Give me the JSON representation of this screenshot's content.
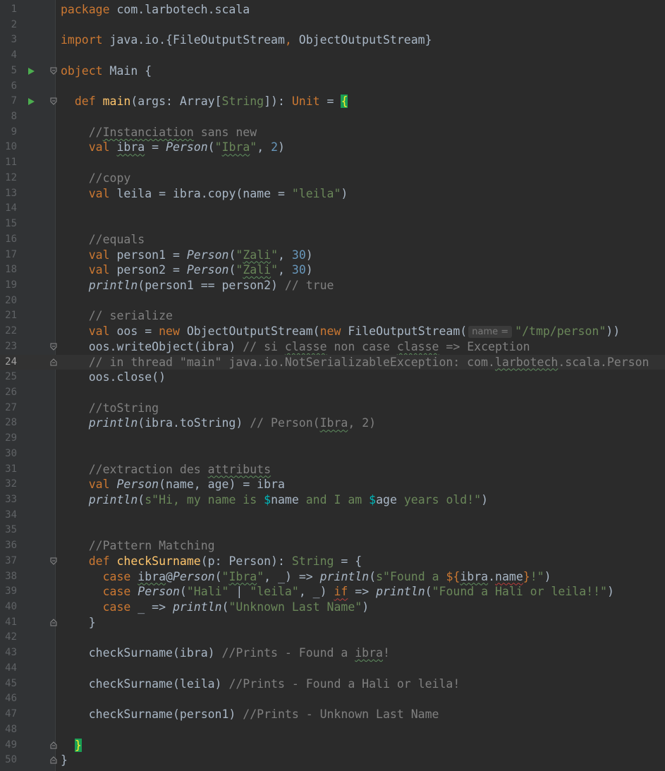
{
  "editor": {
    "language": "scala",
    "current_line": "24",
    "colors": {
      "background": "#2b2b2b",
      "gutter": "#313335",
      "keyword": "#cc7832",
      "string": "#6a8759",
      "number": "#6897bb",
      "comment": "#808080",
      "function": "#ffc66d",
      "run_marker": "#4cae4f",
      "brace_highlight": "#1b9e55"
    },
    "lines": [
      {
        "n": "1"
      },
      {
        "n": "2"
      },
      {
        "n": "3"
      },
      {
        "n": "4"
      },
      {
        "n": "5"
      },
      {
        "n": "6"
      },
      {
        "n": "7"
      },
      {
        "n": "8"
      },
      {
        "n": "9"
      },
      {
        "n": "10"
      },
      {
        "n": "11"
      },
      {
        "n": "12"
      },
      {
        "n": "13"
      },
      {
        "n": "14"
      },
      {
        "n": "15"
      },
      {
        "n": "16"
      },
      {
        "n": "17"
      },
      {
        "n": "18"
      },
      {
        "n": "19"
      },
      {
        "n": "20"
      },
      {
        "n": "21"
      },
      {
        "n": "22"
      },
      {
        "n": "23"
      },
      {
        "n": "24"
      },
      {
        "n": "25"
      },
      {
        "n": "26"
      },
      {
        "n": "27"
      },
      {
        "n": "28"
      },
      {
        "n": "29"
      },
      {
        "n": "30"
      },
      {
        "n": "31"
      },
      {
        "n": "32"
      },
      {
        "n": "33"
      },
      {
        "n": "34"
      },
      {
        "n": "35"
      },
      {
        "n": "36"
      },
      {
        "n": "37"
      },
      {
        "n": "38"
      },
      {
        "n": "39"
      },
      {
        "n": "40"
      },
      {
        "n": "41"
      },
      {
        "n": "42"
      },
      {
        "n": "43"
      },
      {
        "n": "44"
      },
      {
        "n": "45"
      },
      {
        "n": "46"
      },
      {
        "n": "47"
      },
      {
        "n": "48"
      },
      {
        "n": "49"
      },
      {
        "n": "50"
      }
    ],
    "run_markers": [
      "5",
      "7"
    ],
    "fold_markers": [
      "5",
      "7",
      "23",
      "24",
      "37",
      "41",
      "49",
      "50"
    ],
    "code": {
      "l1_kw": "package",
      "l1_rest": " com.larbotech.scala",
      "l3_kw": "import",
      "l3_a": " java.io.{FileOutputStream",
      "l3_comma": ",",
      "l3_b": " ObjectOutputStream}",
      "l5_kw": "object",
      "l5_rest": " Main {",
      "l7_kw": "def",
      "l7_fn": "main",
      "l7_a": "(args: Array[",
      "l7_type": "String",
      "l7_b": "]): ",
      "l7_unit": "Unit",
      "l7_c": " = ",
      "l7_brace": "{",
      "l9_a": "//",
      "l9_b": "Instanciation",
      "l9_c": " sans new",
      "l10_kw": "val",
      "l10_sp": " ",
      "l10_var": "ibra",
      "l10_eq": " = ",
      "l10_cls": "Person",
      "l10_p": "(",
      "l10_q1": "\"",
      "l10_s": "Ibra",
      "l10_q2": "\"",
      "l10_c": ", ",
      "l10_n": "2",
      "l10_e": ")",
      "l12": "//copy",
      "l13_kw": "val",
      "l13_rest": " leila = ibra.copy(name = ",
      "l13_s": "\"leila\"",
      "l13_e": ")",
      "l16": "//equals",
      "l17_kw": "val",
      "l17_a": " person1 = ",
      "l17_cls": "Person",
      "l17_p": "(",
      "l17_q1": "\"",
      "l17_s": "Zali",
      "l17_q2": "\"",
      "l17_c": ", ",
      "l17_n": "30",
      "l17_e": ")",
      "l18_kw": "val",
      "l18_a": " person2 = ",
      "l18_cls": "Person",
      "l18_p": "(",
      "l18_q1": "\"",
      "l18_s": "Zali",
      "l18_q2": "\"",
      "l18_c": ", ",
      "l18_n": "30",
      "l18_e": ")",
      "l19_fn": "println",
      "l19_a": "(person1 == person2) ",
      "l19_com": "// true",
      "l21": "// serialize",
      "l22_kw": "val",
      "l22_a": " oos = ",
      "l22_new": "new",
      "l22_b": " ObjectOutputStream(",
      "l22_new2": "new",
      "l22_c": " FileOutputStream(",
      "l22_hint": "name =",
      "l22_s": "\"/tmp/person\"",
      "l22_e": "))",
      "l23_a": "oos.writeObject(ibra) ",
      "l23_com1": "// si ",
      "l23_w1": "classe",
      "l23_com2": " non case ",
      "l23_w2": "classe",
      "l23_com3": " => Exception",
      "l24_a": "// in thread \"main\" java.io.NotSerializableException: com.",
      "l24_w": "larbotech",
      "l24_b": ".scala.Person",
      "l25": "oos.close()",
      "l27": "//toString",
      "l28_fn": "println",
      "l28_a": "(ibra.toString) ",
      "l28_com1": "// Person(",
      "l28_w": "Ibra",
      "l28_com2": ", 2)",
      "l31_a": "//extraction des ",
      "l31_w": "attributs",
      "l32_kw": "val",
      "l32_sp": " ",
      "l32_cls": "Person",
      "l32_a": "(name, age) = ibra",
      "l33_fn": "println",
      "l33_a": "(",
      "l33_s1": "s\"Hi, my name is ",
      "l33_d1": "$",
      "l33_v1": "name",
      "l33_s2": " and I am ",
      "l33_d2": "$",
      "l33_v2": "age",
      "l33_s3": " years old!\"",
      "l33_e": ")",
      "l36": "//Pattern Matching",
      "l37_kw": "def",
      "l37_sp": " ",
      "l37_fn": "checkSurname",
      "l37_a": "(p: Person): ",
      "l37_type": "String",
      "l37_b": " = {",
      "l38_kw": "case",
      "l38_sp": " ",
      "l38_v": "ibra",
      "l38_at": "@",
      "l38_cls": "Person",
      "l38_p": "(",
      "l38_q1": "\"",
      "l38_s": "Ibra",
      "l38_q2": "\"",
      "l38_c": ", _) => ",
      "l38_fn": "println",
      "l38_p2": "(",
      "l38_s1": "s\"Found a ",
      "l38_d": "${",
      "l38_v1": "ibra",
      "l38_dot": ".",
      "l38_v2": "name",
      "l38_d2": "}",
      "l38_s2": "!\"",
      "l38_e": ")",
      "l39_kw": "case",
      "l39_sp": " ",
      "l39_cls": "Person",
      "l39_p": "(",
      "l39_s1": "\"Hali\"",
      "l39_bar": " | ",
      "l39_s2": "\"leila\"",
      "l39_c": ", _) ",
      "l39_if": "if",
      "l39_arrow": " => ",
      "l39_fn": "println",
      "l39_p2": "(",
      "l39_s3": "\"Found a Hali or leila!!\"",
      "l39_e": ")",
      "l40_kw": "case",
      "l40_a": " _ => ",
      "l40_fn": "println",
      "l40_p": "(",
      "l40_s": "\"Unknown Last Name\"",
      "l40_e": ")",
      "l41": "}",
      "l43_a": "checkSurname(ibra) ",
      "l43_com1": "//Prints - Found a ",
      "l43_w": "ibra",
      "l43_com2": "!",
      "l45_a": "checkSurname(leila) ",
      "l45_com": "//Prints - Found a Hali or leila!",
      "l47_a": "checkSurname(person1) ",
      "l47_com": "//Prints - Unknown Last Name",
      "l49": "}",
      "l50": "}"
    }
  }
}
